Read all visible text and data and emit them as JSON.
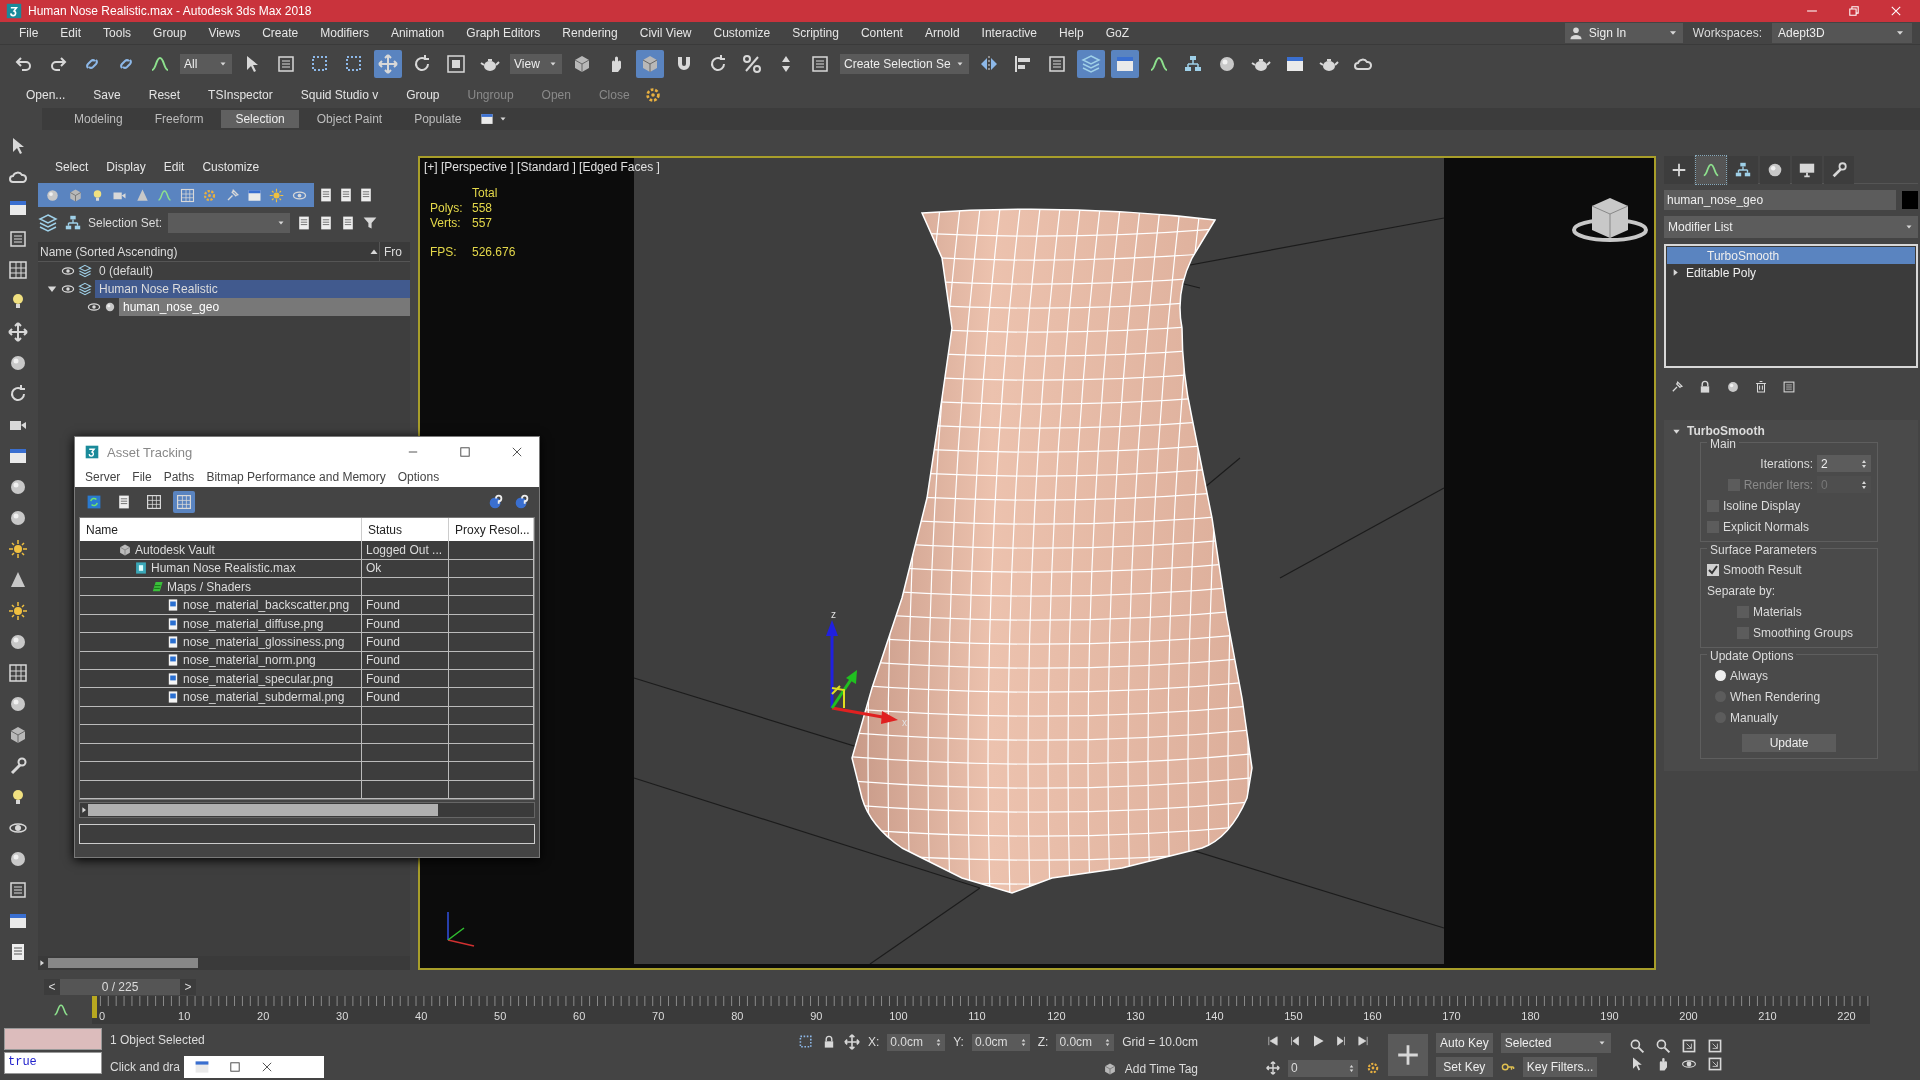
{
  "window": {
    "title": "Human Nose Realistic.max - Autodesk 3ds Max 2018"
  },
  "menu": [
    "File",
    "Edit",
    "Tools",
    "Group",
    "Views",
    "Create",
    "Modifiers",
    "Animation",
    "Graph Editors",
    "Rendering",
    "Civil View",
    "Customize",
    "Scripting",
    "Content",
    "Arnold",
    "Interactive",
    "Help",
    "GoZ"
  ],
  "account": {
    "sign_in": "Sign In",
    "workspaces_label": "Workspaces:",
    "workspace": "Adept3D"
  },
  "main_toolbar": [
    {
      "kind": "tool",
      "selected": false
    },
    {
      "kind": "tool",
      "selected": false
    },
    {
      "kind": "tool",
      "selected": false
    },
    {
      "kind": "tool",
      "selected": false
    },
    {
      "kind": "tool",
      "selected": false
    },
    {
      "kind": "dropdown",
      "label": "All"
    },
    {
      "kind": "tool",
      "selected": false
    },
    {
      "kind": "tool",
      "selected": false
    },
    {
      "kind": "tool",
      "selected": false
    },
    {
      "kind": "tool",
      "selected": false
    },
    {
      "kind": "tool",
      "selected": true
    },
    {
      "kind": "tool",
      "selected": false
    },
    {
      "kind": "tool",
      "selected": false
    },
    {
      "kind": "tool",
      "selected": false
    },
    {
      "kind": "dropdown",
      "label": "View"
    },
    {
      "kind": "tool",
      "selected": false
    },
    {
      "kind": "tool",
      "selected": false
    },
    {
      "kind": "tool",
      "selected": true
    },
    {
      "kind": "tool",
      "selected": false
    },
    {
      "kind": "tool",
      "selected": false
    },
    {
      "kind": "tool",
      "selected": false
    },
    {
      "kind": "tool",
      "selected": false
    },
    {
      "kind": "tool",
      "selected": false
    },
    {
      "kind": "dropdown",
      "label": "Create Selection Se"
    },
    {
      "kind": "tool",
      "selected": false
    },
    {
      "kind": "tool",
      "selected": false
    },
    {
      "kind": "tool",
      "selected": false
    },
    {
      "kind": "tool",
      "selected": true
    },
    {
      "kind": "tool",
      "selected": true
    },
    {
      "kind": "tool",
      "selected": false
    },
    {
      "kind": "tool",
      "selected": false
    },
    {
      "kind": "tool",
      "selected": false
    },
    {
      "kind": "tool",
      "selected": false
    },
    {
      "kind": "tool",
      "selected": false
    },
    {
      "kind": "tool",
      "selected": false
    },
    {
      "kind": "tool",
      "selected": false
    }
  ],
  "custom_toolbar": [
    {
      "label": "Open...",
      "disabled": false
    },
    {
      "label": "Save",
      "disabled": false
    },
    {
      "label": "Reset",
      "disabled": false
    },
    {
      "label": "TSInspector",
      "disabled": false
    },
    {
      "label": "Squid Studio v",
      "disabled": false
    },
    {
      "label": "Group",
      "disabled": false
    },
    {
      "label": "Ungroup",
      "disabled": true
    },
    {
      "label": "Open",
      "disabled": true
    },
    {
      "label": "Close",
      "disabled": true
    }
  ],
  "ribbon_tabs": [
    {
      "label": "Modeling",
      "selected": false
    },
    {
      "label": "Freeform",
      "selected": false
    },
    {
      "label": "Selection",
      "selected": true
    },
    {
      "label": "Object Paint",
      "selected": false
    },
    {
      "label": "Populate",
      "selected": false
    }
  ],
  "scene_explorer": {
    "menu": [
      "Select",
      "Display",
      "Edit",
      "Customize"
    ],
    "selection_set_label": "Selection Set:",
    "column": "Name (Sorted Ascending)",
    "column_2": "Fro",
    "tree": [
      {
        "label": "0 (default)",
        "kind": "layer",
        "selected": false
      },
      {
        "label": "Human Nose Realistic",
        "kind": "layer",
        "selected": true,
        "expanded": true,
        "children": [
          {
            "label": "human_nose_geo",
            "kind": "object",
            "selected": true
          }
        ]
      }
    ]
  },
  "viewport": {
    "label": "[+] [Perspective ] [Standard ] [Edged Faces ]",
    "stats_header": "Total",
    "stats": [
      {
        "label": "Polys:",
        "value": "558"
      },
      {
        "label": "Verts:",
        "value": "557"
      }
    ],
    "fps_label": "FPS:",
    "fps": "526.676",
    "gizmo_axes": [
      "z",
      "x"
    ]
  },
  "asset_tracking": {
    "title": "Asset Tracking",
    "menu": [
      "Server",
      "File",
      "Paths",
      "Bitmap Performance and Memory",
      "Options"
    ],
    "tools": [
      {
        "selected": false
      },
      {
        "selected": false
      },
      {
        "selected": false
      },
      {
        "selected": true
      }
    ],
    "columns": [
      "Name",
      "Status",
      "Proxy Resol..."
    ],
    "rows": [
      {
        "name": "Autodesk Vault",
        "status": "Logged Out ...",
        "kind": "vault",
        "children": [
          {
            "name": "Human Nose Realistic.max",
            "status": "Ok",
            "kind": "scene",
            "children": [
              {
                "name": "Maps / Shaders",
                "kind": "folder",
                "children": [
                  {
                    "name": "nose_material_backscatter.png",
                    "status": "Found",
                    "kind": "bitmap"
                  },
                  {
                    "name": "nose_material_diffuse.png",
                    "status": "Found",
                    "kind": "bitmap"
                  },
                  {
                    "name": "nose_material_glossiness.png",
                    "status": "Found",
                    "kind": "bitmap"
                  },
                  {
                    "name": "nose_material_norm.png",
                    "status": "Found",
                    "kind": "bitmap"
                  },
                  {
                    "name": "nose_material_specular.png",
                    "status": "Found",
                    "kind": "bitmap"
                  },
                  {
                    "name": "nose_material_subdermal.png",
                    "status": "Found",
                    "kind": "bitmap"
                  }
                ]
              }
            ]
          }
        ]
      }
    ]
  },
  "command_panel": {
    "tabs": [
      {
        "selected": false
      },
      {
        "selected": true
      },
      {
        "selected": false
      },
      {
        "selected": false
      },
      {
        "selected": false
      },
      {
        "selected": false
      }
    ],
    "object_name": "human_nose_geo",
    "modifier_list": "Modifier List",
    "stack": [
      {
        "label": "TurboSmooth",
        "selected": true,
        "expandable": false
      },
      {
        "label": "Editable Poly",
        "selected": false,
        "expandable": true
      }
    ],
    "rollout": {
      "title": "TurboSmooth",
      "expanded": true,
      "groups": [
        {
          "title": "Main",
          "controls": [
            {
              "kind": "spinner",
              "label": "Iterations:",
              "value": "2",
              "disabled": false
            },
            {
              "kind": "check-spinner",
              "label": "Render Iters:",
              "value": "0",
              "checked": false,
              "disabled": true
            },
            {
              "kind": "checkbox",
              "label": "Isoline Display",
              "checked": false
            },
            {
              "kind": "checkbox",
              "label": "Explicit Normals",
              "checked": false
            }
          ]
        },
        {
          "title": "Surface Parameters",
          "controls": [
            {
              "kind": "checkbox",
              "label": "Smooth Result",
              "checked": true
            },
            {
              "kind": "label",
              "label": "Separate by:"
            },
            {
              "kind": "sub-checkbox",
              "label": "Materials",
              "checked": false
            },
            {
              "kind": "sub-checkbox",
              "label": "Smoothing Groups",
              "checked": false
            }
          ]
        },
        {
          "title": "Update Options",
          "controls": [
            {
              "kind": "radio",
              "label": "Always",
              "selected": true
            },
            {
              "kind": "radio",
              "label": "When Rendering",
              "selected": false
            },
            {
              "kind": "radio",
              "label": "Manually",
              "selected": false
            },
            {
              "kind": "button",
              "label": "Update"
            }
          ]
        }
      ]
    }
  },
  "timeline": {
    "level": 0,
    "frame_counter": "0 / 225",
    "prev": "<",
    "next": ">",
    "ticks": [
      "0",
      "10",
      "20",
      "30",
      "40",
      "50",
      "60",
      "70",
      "80",
      "90",
      "100",
      "110",
      "120",
      "130",
      "140",
      "150",
      "160",
      "170",
      "180",
      "190",
      "200",
      "210",
      "220"
    ]
  },
  "status_bar": {
    "listener_output": "true",
    "selection": "1 Object Selected",
    "prompt": "Click and dra",
    "x_label": "X:",
    "x": "0.0cm",
    "y_label": "Y:",
    "y": "0.0cm",
    "z_label": "Z:",
    "z": "0.0cm",
    "grid": "Grid = 10.0cm",
    "add_time_tag": "Add Time Tag",
    "auto_key": "Auto Key",
    "set_key": "Set Key",
    "key_set": "Selected",
    "key_filters": "Key Filters...",
    "frame": "0"
  }
}
